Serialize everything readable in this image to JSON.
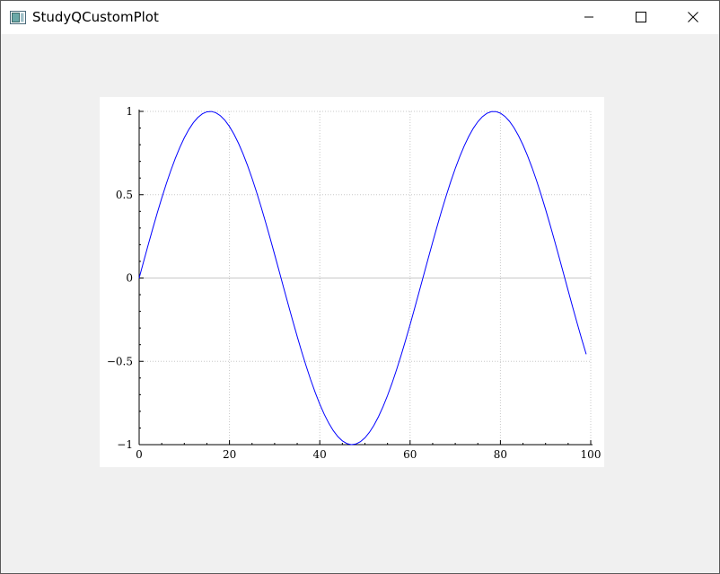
{
  "window": {
    "title": "StudyQCustomPlot"
  },
  "icons": {
    "app": "app-window-icon",
    "minimize": "minimize-icon",
    "maximize": "maximize-icon",
    "close": "close-icon"
  },
  "colors": {
    "line": "#0000ff",
    "grid": "#c8c8c8",
    "zero_line": "#c8c8c8",
    "plot_background": "#ffffff",
    "window_background": "#f0f0f0"
  },
  "chart_data": {
    "type": "line",
    "title": "",
    "xlabel": "",
    "ylabel": "",
    "xlim": [
      0,
      100
    ],
    "ylim": [
      -1,
      1
    ],
    "x_ticks": [
      0,
      20,
      40,
      60,
      80,
      100
    ],
    "x_tick_labels": [
      "0",
      "20",
      "40",
      "60",
      "80",
      "100"
    ],
    "y_ticks": [
      1,
      0.5,
      0,
      -0.5,
      -1
    ],
    "y_tick_labels": [
      "1",
      "0.5",
      "0",
      "−0.5",
      "−1"
    ],
    "grid": true,
    "series": [
      {
        "function": "sin(x/10)",
        "x_start": 0,
        "x_end": 99,
        "x_step": 1
      }
    ]
  }
}
